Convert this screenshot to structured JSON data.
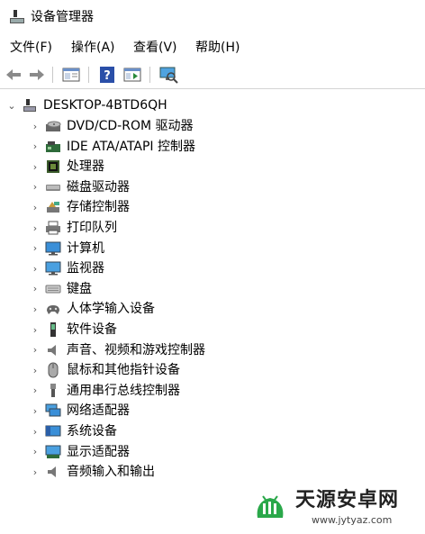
{
  "window": {
    "title": "设备管理器"
  },
  "menu": [
    {
      "label": "文件(F)"
    },
    {
      "label": "操作(A)"
    },
    {
      "label": "查看(V)"
    },
    {
      "label": "帮助(H)"
    }
  ],
  "toolbar": {
    "buttons": [
      "back-icon",
      "forward-icon",
      "properties-icon",
      "help-icon",
      "update-driver-icon",
      "scan-hardware-icon"
    ]
  },
  "tree": {
    "root": {
      "label": "DESKTOP-4BTD6QH",
      "expanded": true,
      "icon": "computer-root-icon"
    },
    "items": [
      {
        "label": "DVD/CD-ROM 驱动器",
        "icon": "dvd-icon"
      },
      {
        "label": "IDE ATA/ATAPI 控制器",
        "icon": "ide-controller-icon"
      },
      {
        "label": "处理器",
        "icon": "processor-icon"
      },
      {
        "label": "磁盘驱动器",
        "icon": "disk-drive-icon"
      },
      {
        "label": "存储控制器",
        "icon": "storage-controller-icon"
      },
      {
        "label": "打印队列",
        "icon": "printer-icon"
      },
      {
        "label": "计算机",
        "icon": "computer-icon"
      },
      {
        "label": "监视器",
        "icon": "monitor-icon"
      },
      {
        "label": "键盘",
        "icon": "keyboard-icon"
      },
      {
        "label": "人体学输入设备",
        "icon": "hid-icon"
      },
      {
        "label": "软件设备",
        "icon": "software-device-icon"
      },
      {
        "label": "声音、视频和游戏控制器",
        "icon": "sound-icon"
      },
      {
        "label": "鼠标和其他指针设备",
        "icon": "mouse-icon"
      },
      {
        "label": "通用串行总线控制器",
        "icon": "usb-icon"
      },
      {
        "label": "网络适配器",
        "icon": "network-adapter-icon"
      },
      {
        "label": "系统设备",
        "icon": "system-device-icon"
      },
      {
        "label": "显示适配器",
        "icon": "display-adapter-icon"
      },
      {
        "label": "音频输入和输出",
        "icon": "audio-io-icon"
      }
    ]
  },
  "watermark": {
    "brand": "天源安卓网",
    "url": "www.jytyaz.com",
    "colors": {
      "green": "#2aa84a"
    }
  }
}
